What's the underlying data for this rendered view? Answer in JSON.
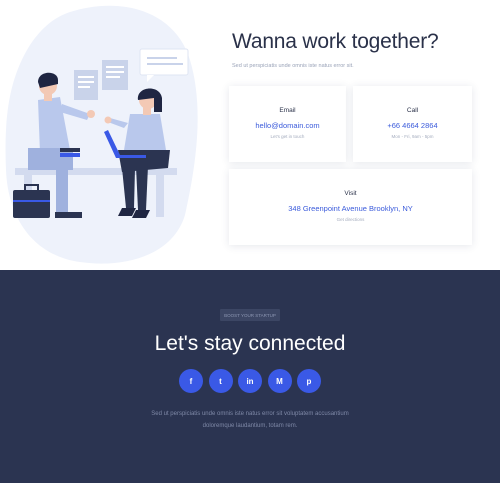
{
  "contact": {
    "heading": "Wanna work together?",
    "subtext": "Sed ut perspiciatis unde omnis iste natus error sit.",
    "cards": [
      {
        "title": "Email",
        "value": "hello@domain.com",
        "note": "Let's get in touch"
      },
      {
        "title": "Call",
        "value": "+66 4664 2864",
        "note": "Mon - Fri, 9am - 5pm"
      },
      {
        "title": "Visit",
        "value": "348 Greenpoint Avenue Brooklyn, NY",
        "note": "Get directions"
      }
    ]
  },
  "connect": {
    "badge": "BOOST YOUR STARTUP",
    "title": "Let's stay connected",
    "socials": [
      {
        "icon": "facebook-icon",
        "glyph": "f"
      },
      {
        "icon": "twitter-icon",
        "glyph": "t"
      },
      {
        "icon": "linkedin-icon",
        "glyph": "in"
      },
      {
        "icon": "medium-icon",
        "glyph": "M"
      },
      {
        "icon": "pinterest-icon",
        "glyph": "p"
      }
    ],
    "text_line1": "Sed ut perspiciatis unde omnis iste natus error sit voluptatem accusantium",
    "text_line2": "doloremque laudantium, totam rem."
  },
  "colors": {
    "accent": "#3a59e6",
    "dark_bg": "#2b3451",
    "heading": "#2a3149"
  }
}
